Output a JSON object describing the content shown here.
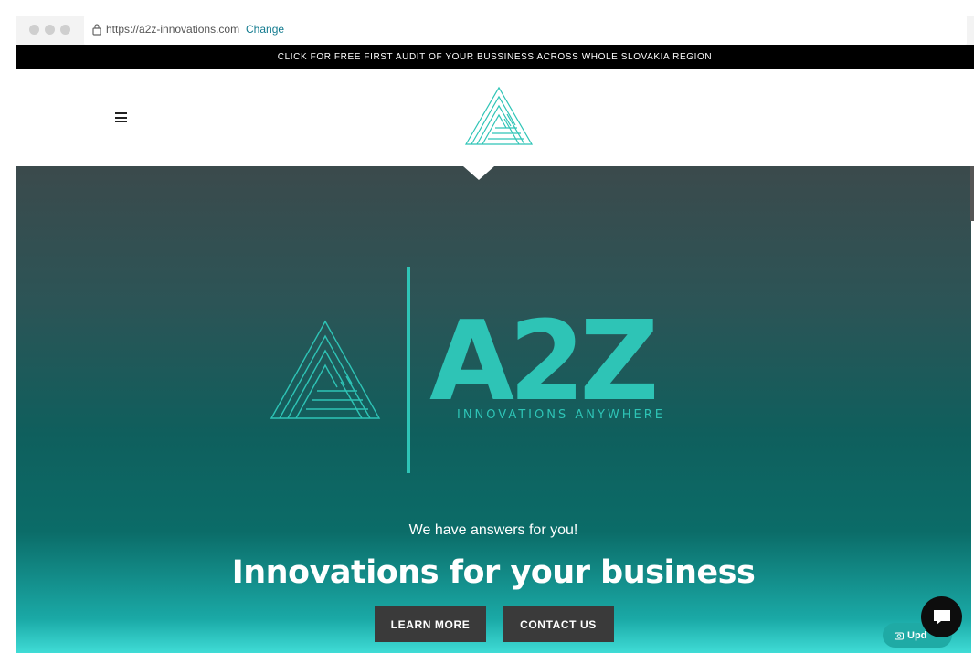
{
  "browser": {
    "url": "https://a2z-innovations.com",
    "change_link": "Change"
  },
  "promo_banner": {
    "text": "CLICK FOR FREE FIRST AUDIT OF YOUR BUSSINESS ACROSS WHOLE SLOVAKIA REGION"
  },
  "header": {
    "menu_icon": "hamburger-icon",
    "logo_icon": "triangle-logo-icon"
  },
  "hero": {
    "logo_text": "A2Z",
    "logo_subtitle": "INNOVATIONS ANYWHERE",
    "tagline": "We have answers for you!",
    "headline": "Innovations for your business",
    "buttons": [
      {
        "label": "LEARN MORE"
      },
      {
        "label": "CONTACT US"
      }
    ]
  },
  "widgets": {
    "chat_icon": "chat-bubble-icon",
    "update_label": "Upd"
  },
  "colors": {
    "accent": "#2ec4b6",
    "banner_bg": "#000000",
    "button_bg": "#3a3a3a"
  }
}
